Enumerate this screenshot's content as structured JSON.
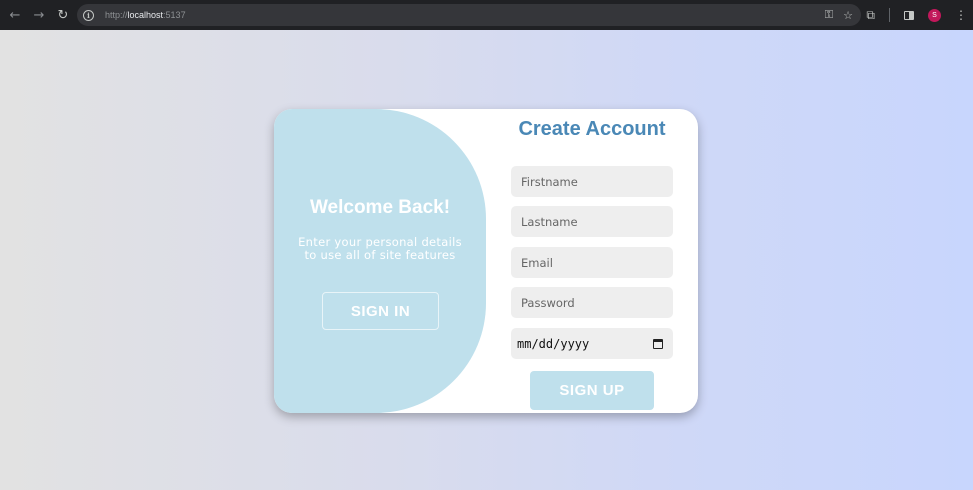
{
  "browser": {
    "url_scheme": "http://",
    "url_host": "localhost",
    "url_port": ":5137",
    "profile_initial": "S",
    "icons": {
      "back": "arrow-left-icon",
      "forward": "arrow-right-icon",
      "reload": "reload-icon",
      "site_info": "info-icon",
      "passwords": "key-icon",
      "bookmark": "star-icon",
      "extensions": "puzzle-icon",
      "side_panel": "side-panel-icon",
      "menu": "kebab-menu-icon"
    }
  },
  "welcome": {
    "title": "Welcome Back!",
    "text": "Enter your personal details to use all of site features",
    "signin_label": "SIGN IN"
  },
  "form": {
    "title": "Create Account",
    "firstname_placeholder": "Firstname",
    "lastname_placeholder": "Lastname",
    "email_placeholder": "Email",
    "password_placeholder": "Password",
    "date_placeholder": "mm/dd/yyyy",
    "signup_label": "SIGN UP"
  },
  "colors": {
    "panel": "#bfe0ec",
    "title": "#4a88b6",
    "field_bg": "#eeeeee"
  }
}
